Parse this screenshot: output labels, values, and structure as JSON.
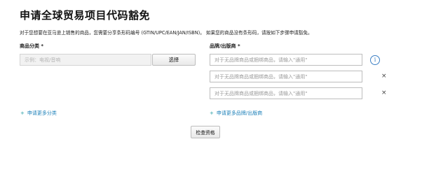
{
  "title": "申请全球贸易项目代码豁免",
  "description": "对于您想要在亚马逊上销售的商品，您需要分享条形码编号 (GTIN/UPC/EAN/JAN/ISBN)。 如果您的商品没有条形码，请按如下步骤申请豁免。",
  "category": {
    "label": "商品分类 *",
    "placeholder": "示例：电视/音响",
    "select_button": "选择",
    "add_more_link": "申请更多分类"
  },
  "brand": {
    "label": "品牌/出版商 *",
    "inputs": [
      {
        "placeholder": "对于无品牌商品或捆绑商品，请输入\"通用\""
      },
      {
        "placeholder": "对于无品牌商品或捆绑商品，请输入\"通用\""
      },
      {
        "placeholder": "对于无品牌商品或捆绑商品，请输入\"通用\""
      }
    ],
    "info_icon": "i",
    "remove_icon": "×",
    "add_more_link": "申请更多品牌/出版商"
  },
  "link_prefix_icon": "+",
  "check_button": "检查资格"
}
